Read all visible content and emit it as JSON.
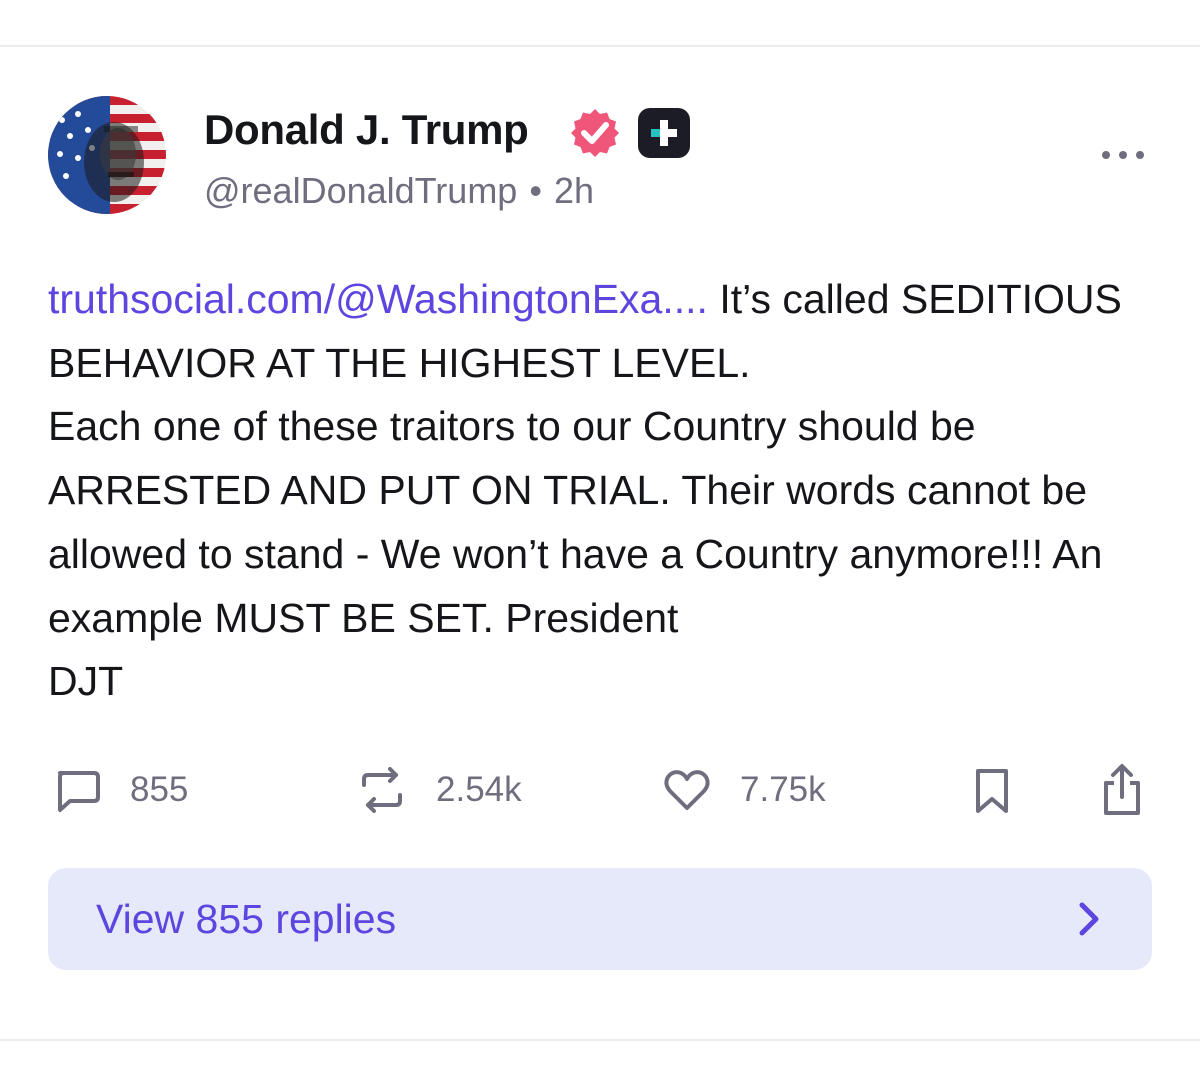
{
  "post": {
    "author": {
      "display_name": "Donald J. Trump",
      "handle": "@realDonaldTrump",
      "timestamp": "2h",
      "verified_icon": "verified-badge-icon",
      "plus_icon": "truth-plus-icon"
    },
    "body": {
      "link_text": "truthsocial.com/@WashingtonExa....",
      "text": " It’s called SEDITIOUS BEHAVIOR AT THE HIGHEST LEVEL.\nEach one of these traitors to our Country should be ARRESTED AND PUT ON TRIAL. Their words cannot be allowed to stand - We won’t have a Country anymore!!! An example MUST BE SET. President\nDJT"
    },
    "actions": {
      "replies": "855",
      "retruths": "2.54k",
      "likes": "7.75k"
    },
    "view_replies_label": "View 855 replies"
  },
  "colors": {
    "accent": "#5d46e0",
    "text_primary": "#15161a",
    "text_secondary": "#6f6e7e",
    "verified": "#f0557a",
    "replies_bg": "#e6e9fa"
  }
}
